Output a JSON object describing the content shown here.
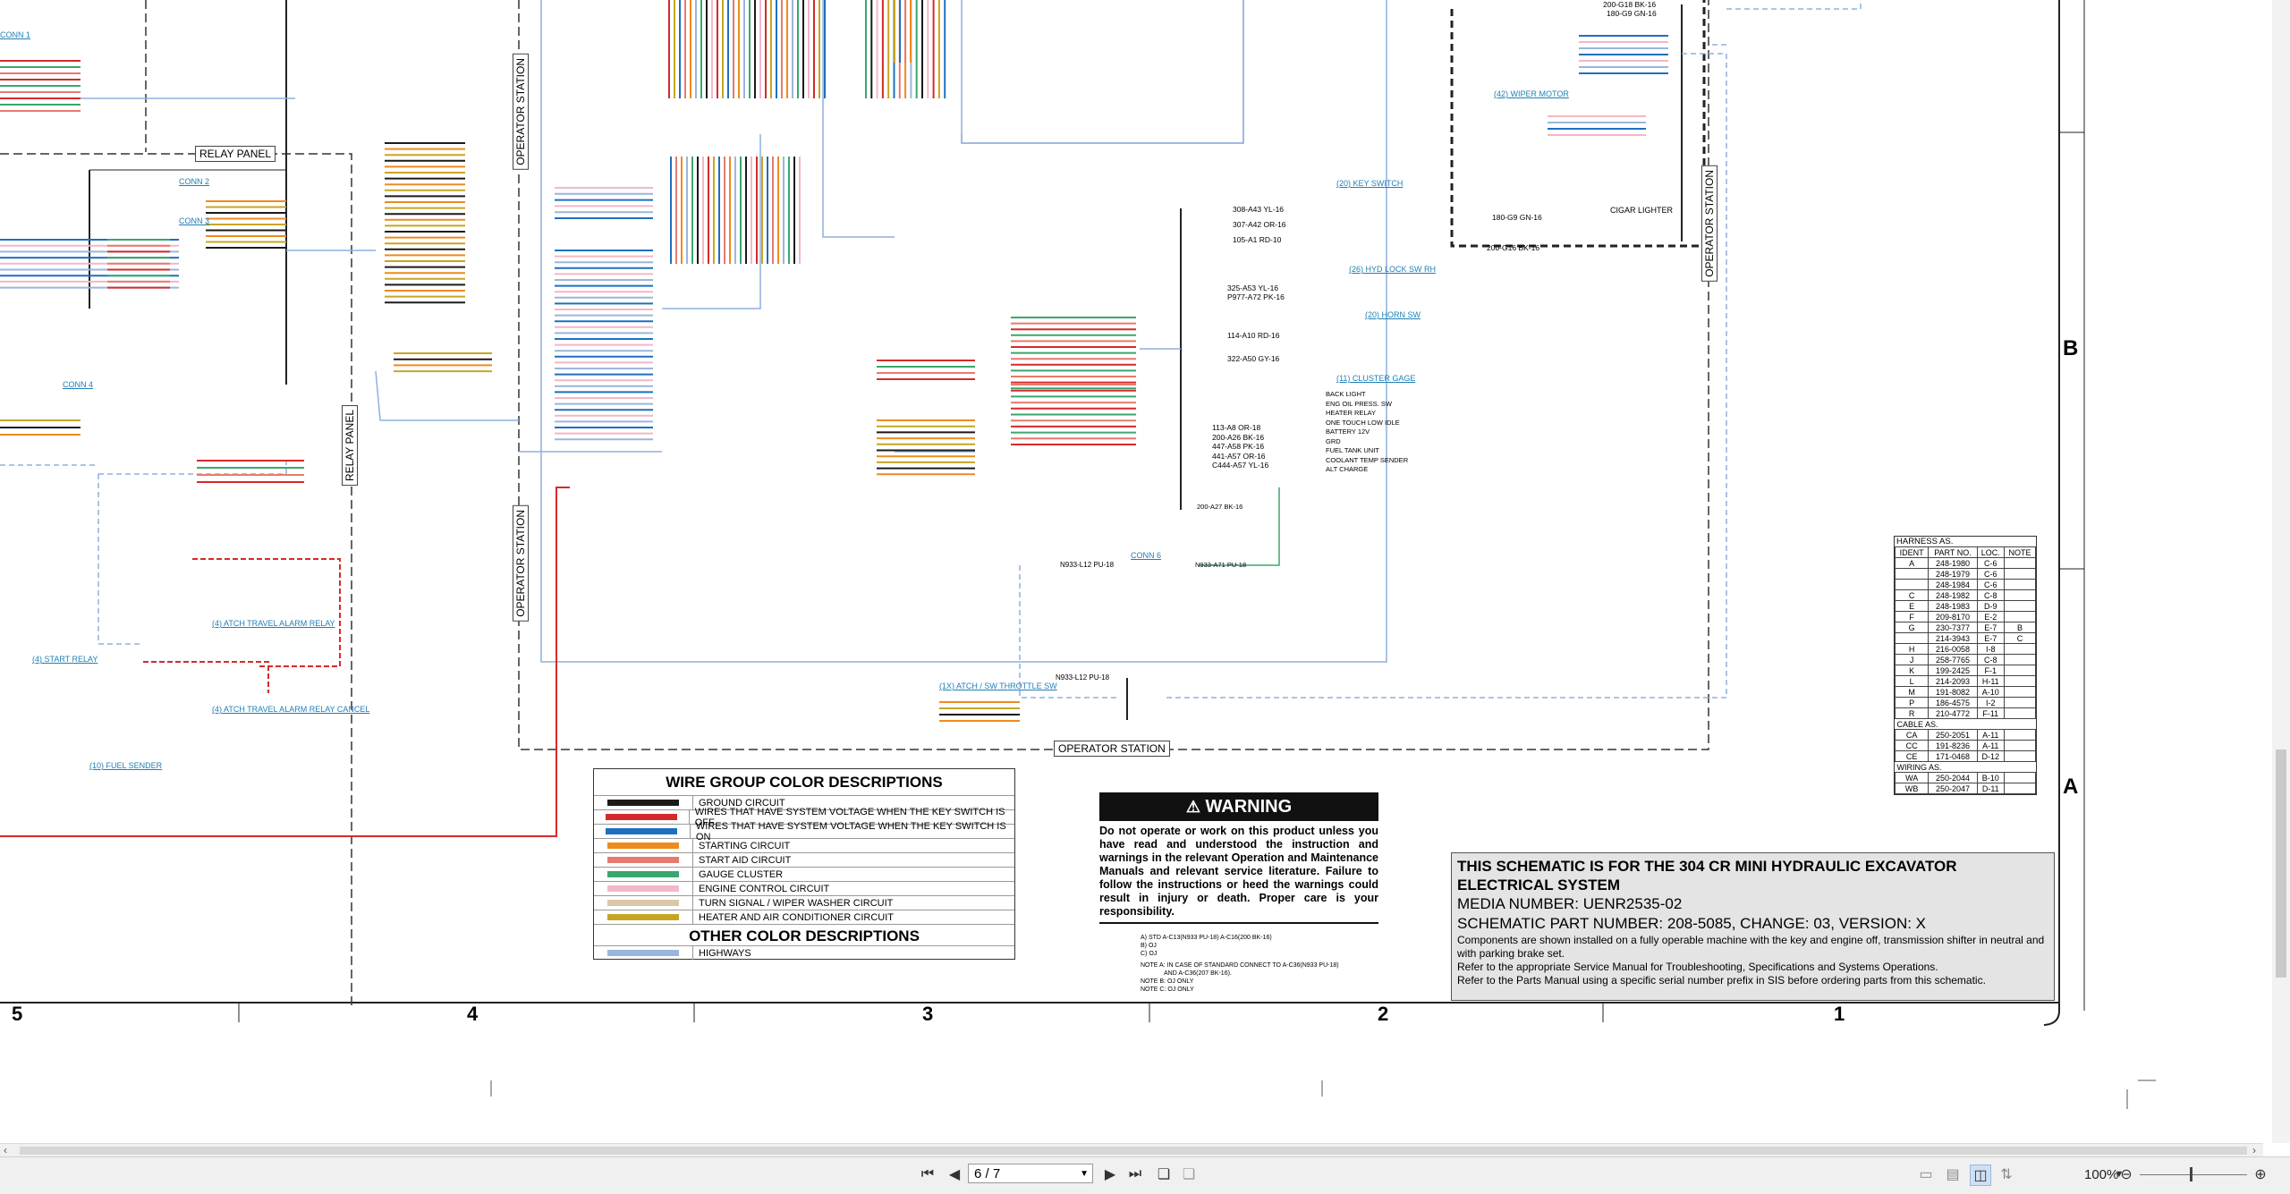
{
  "sheet": {
    "relay_panel": "RELAY PANEL",
    "operator_station": "OPERATOR STATION",
    "conn_labels": [
      "CONN 1",
      "CONN 2",
      "CONN 3",
      "CONN 4",
      "CONN 6"
    ],
    "component_labels": {
      "key_switch": "(20) KEY SWITCH",
      "wiper_motor": "(42) WIPER MOTOR",
      "hyd_lock": "(26) HYD LOCK SW RH",
      "horn": "(20) HORN SW",
      "cluster": "(11) CLUSTER GAGE",
      "start_relay": "(4) START RELAY",
      "fuel_sender": "(10) FUEL SENDER",
      "travel_alarm": "(4) ATCH TRAVEL ALARM RELAY",
      "travel_alarm_cancel": "(4) ATCH TRAVEL ALARM RELAY CANCEL",
      "throttle": "(1X) ATCH / SW THROTTLE SW",
      "cigar": "CIGAR LIGHTER"
    },
    "cluster_pins": [
      "BACK LIGHT",
      "ENG OIL PRESS. SW",
      "HEATER RELAY",
      "ONE TOUCH LOW IDLE",
      "",
      "BATTERY 12V",
      "GRD",
      "",
      "FUEL TANK UNIT",
      "COOLANT TEMP SENDER",
      "ALT CHARGE"
    ],
    "wire_samples": [
      "308-A43 YL-16",
      "307-A42 OR-16",
      "105-A1 RD-10",
      "325-A53 YL-16",
      "P977-A72 PK-16",
      "114-A10 RD-16",
      "322-A50 GY-16",
      "113-A8 OR-18",
      "200-A26 BK-16",
      "447-A58 PK-16",
      "441-A57 OR-16",
      "C444-A57 YL-16",
      "200-A27 BK-16",
      "N933-L12 PU-18",
      "N933-A71 PU-18",
      "200-G18 BK-16",
      "180-G9 GN-16",
      "200-G16 BK-16"
    ]
  },
  "legend": {
    "title": "WIRE GROUP COLOR DESCRIPTIONS",
    "rows": [
      {
        "color": "#1a1a1a",
        "text": "GROUND CIRCUIT"
      },
      {
        "color": "#d62a2a",
        "text": "WIRES THAT HAVE SYSTEM VOLTAGE WHEN THE KEY SWITCH IS OFF"
      },
      {
        "color": "#1e6fc2",
        "text": "WIRES THAT HAVE SYSTEM VOLTAGE WHEN THE KEY SWITCH IS ON"
      },
      {
        "color": "#ef8a1d",
        "text": "STARTING CIRCUIT"
      },
      {
        "color": "#e8796f",
        "text": "START AID CIRCUIT"
      },
      {
        "color": "#3aa76d",
        "text": "GAUGE CLUSTER"
      },
      {
        "color": "#f4b7c7",
        "text": "ENGINE CONTROL CIRCUIT"
      },
      {
        "color": "#d9c7a8",
        "text": "TURN SIGNAL / WIPER WASHER CIRCUIT"
      },
      {
        "color": "#c7a524",
        "text": "HEATER AND AIR CONDITIONER CIRCUIT"
      }
    ],
    "other_title": "OTHER COLOR DESCRIPTIONS",
    "other_rows": [
      {
        "color": "#9ab6dc",
        "text": "HIGHWAYS"
      }
    ]
  },
  "warning": {
    "heading": "WARNING",
    "body": "Do not operate or work on this product unless you have read and understood the instruction and warnings in the relevant Operation and Maintenance Manuals and relevant service literature. Failure to follow the instructions or heed the warnings could result in injury or death. Proper care is your responsibility."
  },
  "notes": {
    "line1": "A) STD   A-C13(N933 PU-18) A-C16(200 BK-16)",
    "line2": "B) OJ",
    "line3": "C) OJ",
    "line4": "NOTE A: IN CASE OF STANDARD CONNECT TO A-C36(N933 PU-18)",
    "line5": "AND A-C36(207 BK-16).",
    "line6": "NOTE B: OJ ONLY",
    "line7": "NOTE C: OJ ONLY"
  },
  "titleblock": {
    "line1": "THIS SCHEMATIC IS FOR THE 304 CR MINI HYDRAULIC EXCAVATOR",
    "line2": "ELECTRICAL SYSTEM",
    "media": "MEDIA NUMBER: UENR2535-02",
    "part": "SCHEMATIC PART NUMBER: 208-5085, CHANGE: 03, VERSION: X",
    "p1": "Components are shown installed on a fully operable machine with the key and engine off, transmission shifter in neutral and with parking brake set.",
    "p2": "Refer to the appropriate Service Manual for Troubleshooting, Specifications and Systems Operations.",
    "p3": "Refer to the Parts Manual using a specific serial number prefix in SIS before ordering parts from this schematic."
  },
  "harness_table": {
    "title": "HARNESS AS.",
    "headers": [
      "IDENT",
      "PART NO.",
      "LOC.",
      "NOTE"
    ],
    "rows": [
      [
        "A",
        "248-1980",
        "C-6",
        ""
      ],
      [
        "",
        "248-1979",
        "C-6",
        ""
      ],
      [
        "",
        "248-1984",
        "C-6",
        ""
      ],
      [
        "C",
        "248-1982",
        "C-8",
        ""
      ],
      [
        "E",
        "248-1983",
        "D-9",
        ""
      ],
      [
        "F",
        "209-8170",
        "E-2",
        ""
      ],
      [
        "G",
        "230-7377",
        "E-7",
        "B"
      ],
      [
        "",
        "214-3943",
        "E-7",
        "C"
      ],
      [
        "H",
        "216-0058",
        "I-8",
        ""
      ],
      [
        "J",
        "258-7765",
        "C-8",
        ""
      ],
      [
        "K",
        "199-2425",
        "F-1",
        ""
      ],
      [
        "L",
        "214-2093",
        "H-11",
        ""
      ],
      [
        "M",
        "191-8082",
        "A-10",
        ""
      ],
      [
        "P",
        "186-4575",
        "I-2",
        ""
      ],
      [
        "R",
        "210-4772",
        "F-11",
        ""
      ]
    ],
    "cable_title": "CABLE AS.",
    "cable_rows": [
      [
        "CA",
        "250-2051",
        "A-11",
        ""
      ],
      [
        "CC",
        "191-8236",
        "A-11",
        ""
      ],
      [
        "CE",
        "171-0468",
        "D-12",
        ""
      ]
    ],
    "wiring_title": "WIRING AS.",
    "wiring_rows": [
      [
        "WA",
        "250-2044",
        "B-10",
        ""
      ],
      [
        "WB",
        "250-2047",
        "D-11",
        ""
      ]
    ]
  },
  "zones": {
    "numbers": [
      "5",
      "4",
      "3",
      "2",
      "1"
    ],
    "letters": [
      "B",
      "A"
    ]
  },
  "viewer": {
    "page_value": "6 / 7",
    "zoom": "100%"
  }
}
